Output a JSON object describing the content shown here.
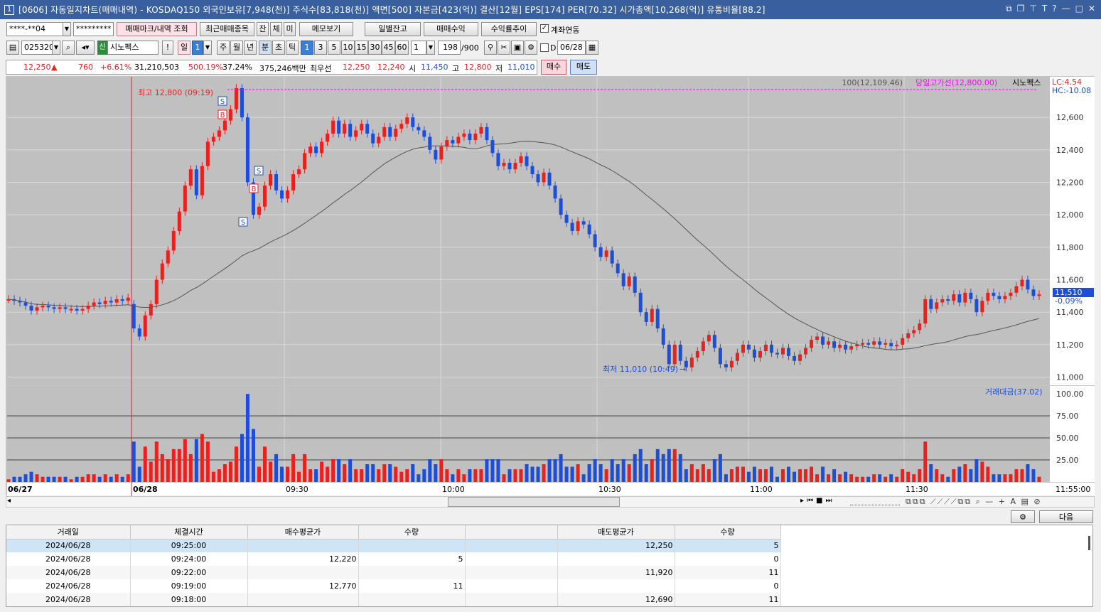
{
  "window": {
    "badge": "1",
    "title": "[0606] 자동일지차트(매매내역) - KOSDAQ150 외국인보유[7,948(천)] 주식수[83,818(천)] 액면[500] 자본금[423(억)] 결산[12월] EPS[174] PER[70.32] 시가총액[10,268(억)] 유통비율[88.2]"
  },
  "toolbar1": {
    "account": "****-**04",
    "password": "*********",
    "mark_btn": "매매마크/내역 조회",
    "recent_btn": "최근매매종목",
    "jan": "잔",
    "che": "체",
    "mi": "미",
    "memo": "메모보기",
    "daily_balance": "일별잔고",
    "trade_profit": "매매수익",
    "profit_trend": "수익률추이",
    "account_link": "계좌연동"
  },
  "toolbar2": {
    "code": "025320",
    "sin": "신",
    "stock_name": "시노펙스",
    "excl": "!",
    "day": "일",
    "day_n": "1",
    "week": "주",
    "month": "월",
    "year": "년",
    "min": "분",
    "sec": "초",
    "tick": "틱",
    "intervals": [
      "1",
      "3",
      "5",
      "10",
      "15",
      "30",
      "45",
      "60"
    ],
    "count": "1",
    "bars": "198",
    "bars_max": "/900",
    "d_label": "D",
    "date": "06/28"
  },
  "quote": {
    "price": "12,250",
    "arrow": "▲",
    "change": "760",
    "pct": "+6.61%",
    "volume": "31,210,503",
    "vol_ratio": "500.19%",
    "turnover": "37.24%",
    "amount": "375,246백만",
    "best_label": "최우선",
    "ask": "12,250",
    "bid": "12,240",
    "open_label": "시",
    "open": "11,450",
    "high_label": "고",
    "high": "12,800",
    "low_label": "저",
    "low": "11,010",
    "buy": "매수",
    "sell": "매도"
  },
  "colors": {
    "up": "#e8211f",
    "down": "#1d4ed8",
    "ma": "#555555",
    "hline": "#ff00ff"
  },
  "chart": {
    "top_info": "100(12,109.46)",
    "high_line_label": "당일고가선(12,800.00)",
    "legend_name": "시노펙스",
    "lc": "LC:4.54",
    "hc": "HC:-10.08",
    "high_note": "최고 12,800 (09:19)",
    "low_note": "최저 11,010 (10:49)",
    "cur_price": "11,510",
    "cur_pct": "-0.09%",
    "marks": [
      "S",
      "B",
      "S",
      "B",
      "S"
    ],
    "vol_legend": "거래대금(37.02)",
    "x_labels": [
      "06/27",
      "06/28",
      "09:30",
      "10:00",
      "10:30",
      "11:00",
      "11:30",
      "11:55:00"
    ]
  },
  "chart_data": {
    "type": "candlestick",
    "y_ticks": [
      "12,600",
      "12,400",
      "12,200",
      "12,000",
      "11,800",
      "11,600",
      "11,400",
      "11,200",
      "11,000"
    ],
    "ylim": [
      10950,
      12850
    ],
    "vol_ticks": [
      "100.00",
      "75.00",
      "50.00",
      "25.00"
    ],
    "vol_ylim": [
      0,
      105
    ],
    "candles": [
      {
        "o": 11480,
        "c": 11480
      },
      {
        "o": 11480,
        "c": 11470
      },
      {
        "o": 11470,
        "c": 11460
      },
      {
        "o": 11460,
        "c": 11440
      },
      {
        "o": 11440,
        "c": 11410
      },
      {
        "o": 11410,
        "c": 11430
      },
      {
        "o": 11430,
        "c": 11440
      },
      {
        "o": 11440,
        "c": 11430
      },
      {
        "o": 11430,
        "c": 11420
      },
      {
        "o": 11420,
        "c": 11430
      },
      {
        "o": 11430,
        "c": 11420
      },
      {
        "o": 11420,
        "c": 11420
      },
      {
        "o": 11420,
        "c": 11410
      },
      {
        "o": 11410,
        "c": 11420
      },
      {
        "o": 11420,
        "c": 11440
      },
      {
        "o": 11440,
        "c": 11460
      },
      {
        "o": 11460,
        "c": 11450
      },
      {
        "o": 11450,
        "c": 11470
      },
      {
        "o": 11470,
        "c": 11460
      },
      {
        "o": 11460,
        "c": 11480
      },
      {
        "o": 11480,
        "c": 11470
      },
      {
        "o": 11470,
        "c": 11490
      },
      {
        "o": 11450,
        "c": 11300
      },
      {
        "o": 11300,
        "c": 11250
      },
      {
        "o": 11250,
        "c": 11380
      },
      {
        "o": 11380,
        "c": 11450
      },
      {
        "o": 11450,
        "c": 11600
      },
      {
        "o": 11600,
        "c": 11700
      },
      {
        "o": 11700,
        "c": 11780
      },
      {
        "o": 11780,
        "c": 11900
      },
      {
        "o": 11900,
        "c": 12020
      },
      {
        "o": 12020,
        "c": 12180
      },
      {
        "o": 12180,
        "c": 12280
      },
      {
        "o": 12280,
        "c": 12120
      },
      {
        "o": 12120,
        "c": 12300
      },
      {
        "o": 12300,
        "c": 12450
      },
      {
        "o": 12450,
        "c": 12480
      },
      {
        "o": 12480,
        "c": 12520
      },
      {
        "o": 12520,
        "c": 12580
      },
      {
        "o": 12580,
        "c": 12650
      },
      {
        "o": 12650,
        "c": 12780
      },
      {
        "o": 12780,
        "c": 12600
      },
      {
        "o": 12600,
        "c": 12200
      },
      {
        "o": 12200,
        "c": 12000
      },
      {
        "o": 12000,
        "c": 12050
      },
      {
        "o": 12050,
        "c": 12180
      },
      {
        "o": 12180,
        "c": 12250
      },
      {
        "o": 12250,
        "c": 12150
      },
      {
        "o": 12150,
        "c": 12100
      },
      {
        "o": 12100,
        "c": 12150
      },
      {
        "o": 12150,
        "c": 12250
      },
      {
        "o": 12250,
        "c": 12280
      },
      {
        "o": 12280,
        "c": 12380
      },
      {
        "o": 12380,
        "c": 12420
      },
      {
        "o": 12420,
        "c": 12380
      },
      {
        "o": 12380,
        "c": 12450
      },
      {
        "o": 12450,
        "c": 12500
      },
      {
        "o": 12500,
        "c": 12580
      },
      {
        "o": 12580,
        "c": 12500
      },
      {
        "o": 12500,
        "c": 12560
      },
      {
        "o": 12560,
        "c": 12480
      },
      {
        "o": 12480,
        "c": 12520
      },
      {
        "o": 12520,
        "c": 12560
      },
      {
        "o": 12560,
        "c": 12500
      },
      {
        "o": 12500,
        "c": 12440
      },
      {
        "o": 12440,
        "c": 12480
      },
      {
        "o": 12480,
        "c": 12540
      },
      {
        "o": 12540,
        "c": 12480
      },
      {
        "o": 12480,
        "c": 12530
      },
      {
        "o": 12530,
        "c": 12560
      },
      {
        "o": 12560,
        "c": 12600
      },
      {
        "o": 12600,
        "c": 12540
      },
      {
        "o": 12540,
        "c": 12520
      },
      {
        "o": 12520,
        "c": 12480
      },
      {
        "o": 12480,
        "c": 12400
      },
      {
        "o": 12400,
        "c": 12340
      },
      {
        "o": 12340,
        "c": 12420
      },
      {
        "o": 12420,
        "c": 12460
      },
      {
        "o": 12460,
        "c": 12440
      },
      {
        "o": 12440,
        "c": 12480
      },
      {
        "o": 12480,
        "c": 12500
      },
      {
        "o": 12500,
        "c": 12460
      },
      {
        "o": 12460,
        "c": 12500
      },
      {
        "o": 12500,
        "c": 12540
      },
      {
        "o": 12540,
        "c": 12460
      },
      {
        "o": 12460,
        "c": 12380
      },
      {
        "o": 12380,
        "c": 12300
      },
      {
        "o": 12300,
        "c": 12320
      },
      {
        "o": 12320,
        "c": 12280
      },
      {
        "o": 12280,
        "c": 12320
      },
      {
        "o": 12320,
        "c": 12360
      },
      {
        "o": 12360,
        "c": 12300
      },
      {
        "o": 12300,
        "c": 12250
      },
      {
        "o": 12250,
        "c": 12200
      },
      {
        "o": 12200,
        "c": 12260
      },
      {
        "o": 12260,
        "c": 12180
      },
      {
        "o": 12180,
        "c": 12100
      },
      {
        "o": 12100,
        "c": 12000
      },
      {
        "o": 12000,
        "c": 11950
      },
      {
        "o": 11950,
        "c": 11900
      },
      {
        "o": 11900,
        "c": 11960
      },
      {
        "o": 11960,
        "c": 11940
      },
      {
        "o": 11940,
        "c": 11880
      },
      {
        "o": 11880,
        "c": 11800
      },
      {
        "o": 11800,
        "c": 11740
      },
      {
        "o": 11740,
        "c": 11780
      },
      {
        "o": 11780,
        "c": 11700
      },
      {
        "o": 11700,
        "c": 11640
      },
      {
        "o": 11640,
        "c": 11560
      },
      {
        "o": 11560,
        "c": 11620
      },
      {
        "o": 11620,
        "c": 11520
      },
      {
        "o": 11520,
        "c": 11400
      },
      {
        "o": 11400,
        "c": 11340
      },
      {
        "o": 11340,
        "c": 11420
      },
      {
        "o": 11420,
        "c": 11300
      },
      {
        "o": 11300,
        "c": 11200
      },
      {
        "o": 11200,
        "c": 11080
      },
      {
        "o": 11080,
        "c": 11200
      },
      {
        "o": 11200,
        "c": 11100
      },
      {
        "o": 11100,
        "c": 11060
      },
      {
        "o": 11060,
        "c": 11120
      },
      {
        "o": 11120,
        "c": 11160
      },
      {
        "o": 11160,
        "c": 11220
      },
      {
        "o": 11220,
        "c": 11260
      },
      {
        "o": 11260,
        "c": 11180
      },
      {
        "o": 11180,
        "c": 11080
      },
      {
        "o": 11080,
        "c": 11060
      },
      {
        "o": 11060,
        "c": 11100
      },
      {
        "o": 11100,
        "c": 11150
      },
      {
        "o": 11150,
        "c": 11200
      },
      {
        "o": 11200,
        "c": 11170
      },
      {
        "o": 11170,
        "c": 11120
      },
      {
        "o": 11120,
        "c": 11160
      },
      {
        "o": 11160,
        "c": 11200
      },
      {
        "o": 11200,
        "c": 11150
      },
      {
        "o": 11150,
        "c": 11140
      },
      {
        "o": 11140,
        "c": 11180
      },
      {
        "o": 11180,
        "c": 11130
      },
      {
        "o": 11130,
        "c": 11100
      },
      {
        "o": 11100,
        "c": 11140
      },
      {
        "o": 11140,
        "c": 11180
      },
      {
        "o": 11180,
        "c": 11230
      },
      {
        "o": 11230,
        "c": 11250
      },
      {
        "o": 11250,
        "c": 11200
      },
      {
        "o": 11200,
        "c": 11220
      },
      {
        "o": 11220,
        "c": 11180
      },
      {
        "o": 11180,
        "c": 11200
      },
      {
        "o": 11200,
        "c": 11170
      },
      {
        "o": 11170,
        "c": 11190
      },
      {
        "o": 11190,
        "c": 11200
      },
      {
        "o": 11200,
        "c": 11210
      },
      {
        "o": 11210,
        "c": 11200
      },
      {
        "o": 11200,
        "c": 11220
      },
      {
        "o": 11220,
        "c": 11200
      },
      {
        "o": 11200,
        "c": 11210
      },
      {
        "o": 11210,
        "c": 11190
      },
      {
        "o": 11190,
        "c": 11200
      },
      {
        "o": 11200,
        "c": 11240
      },
      {
        "o": 11240,
        "c": 11270
      },
      {
        "o": 11270,
        "c": 11290
      },
      {
        "o": 11290,
        "c": 11330
      },
      {
        "o": 11330,
        "c": 11480
      },
      {
        "o": 11480,
        "c": 11420
      },
      {
        "o": 11420,
        "c": 11460
      },
      {
        "o": 11460,
        "c": 11480
      },
      {
        "o": 11480,
        "c": 11470
      },
      {
        "o": 11470,
        "c": 11510
      },
      {
        "o": 11510,
        "c": 11460
      },
      {
        "o": 11460,
        "c": 11520
      },
      {
        "o": 11520,
        "c": 11480
      },
      {
        "o": 11480,
        "c": 11400
      },
      {
        "o": 11400,
        "c": 11470
      },
      {
        "o": 11470,
        "c": 11520
      },
      {
        "o": 11520,
        "c": 11500
      },
      {
        "o": 11500,
        "c": 11480
      },
      {
        "o": 11480,
        "c": 11500
      },
      {
        "o": 11500,
        "c": 11520
      },
      {
        "o": 11520,
        "c": 11560
      },
      {
        "o": 11560,
        "c": 11600
      },
      {
        "o": 11600,
        "c": 11540
      },
      {
        "o": 11540,
        "c": 11500
      },
      {
        "o": 11500,
        "c": 11510
      }
    ]
  },
  "table": {
    "headers": [
      "거래일",
      "체결시간",
      "매수평균가",
      "수량",
      "",
      "매도평균가",
      "수량"
    ],
    "rows": [
      [
        "2024/06/28",
        "09:25:00",
        "",
        "",
        "",
        "12,250",
        "5"
      ],
      [
        "2024/06/28",
        "09:24:00",
        "12,220",
        "5",
        "",
        "",
        "0"
      ],
      [
        "2024/06/28",
        "09:22:00",
        "",
        "",
        "",
        "11,920",
        "11"
      ],
      [
        "2024/06/28",
        "09:19:00",
        "12,770",
        "11",
        "",
        "",
        "0"
      ],
      [
        "2024/06/28",
        "09:18:00",
        "",
        "",
        "",
        "12,690",
        "11"
      ]
    ],
    "next_btn": "다음"
  }
}
